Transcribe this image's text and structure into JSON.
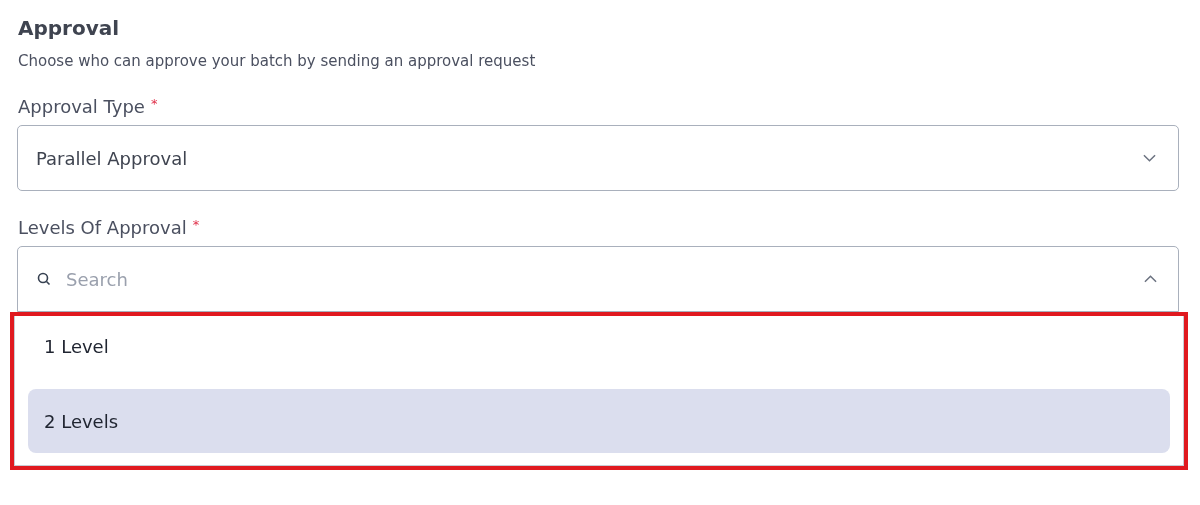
{
  "section": {
    "title": "Approval",
    "description": "Choose who can approve your batch by sending an approval request"
  },
  "fields": [
    {
      "kind": "select",
      "label": "Approval Type",
      "required": "*",
      "value": "Parallel Approval",
      "expanded": false
    },
    {
      "kind": "search",
      "label": "Levels Of Approval",
      "required": "*",
      "placeholder": "Search",
      "expanded": true,
      "highlighted": true,
      "options": [
        {
          "label": "1 Level",
          "selected": false
        },
        {
          "label": "2 Levels",
          "selected": true
        }
      ]
    }
  ]
}
